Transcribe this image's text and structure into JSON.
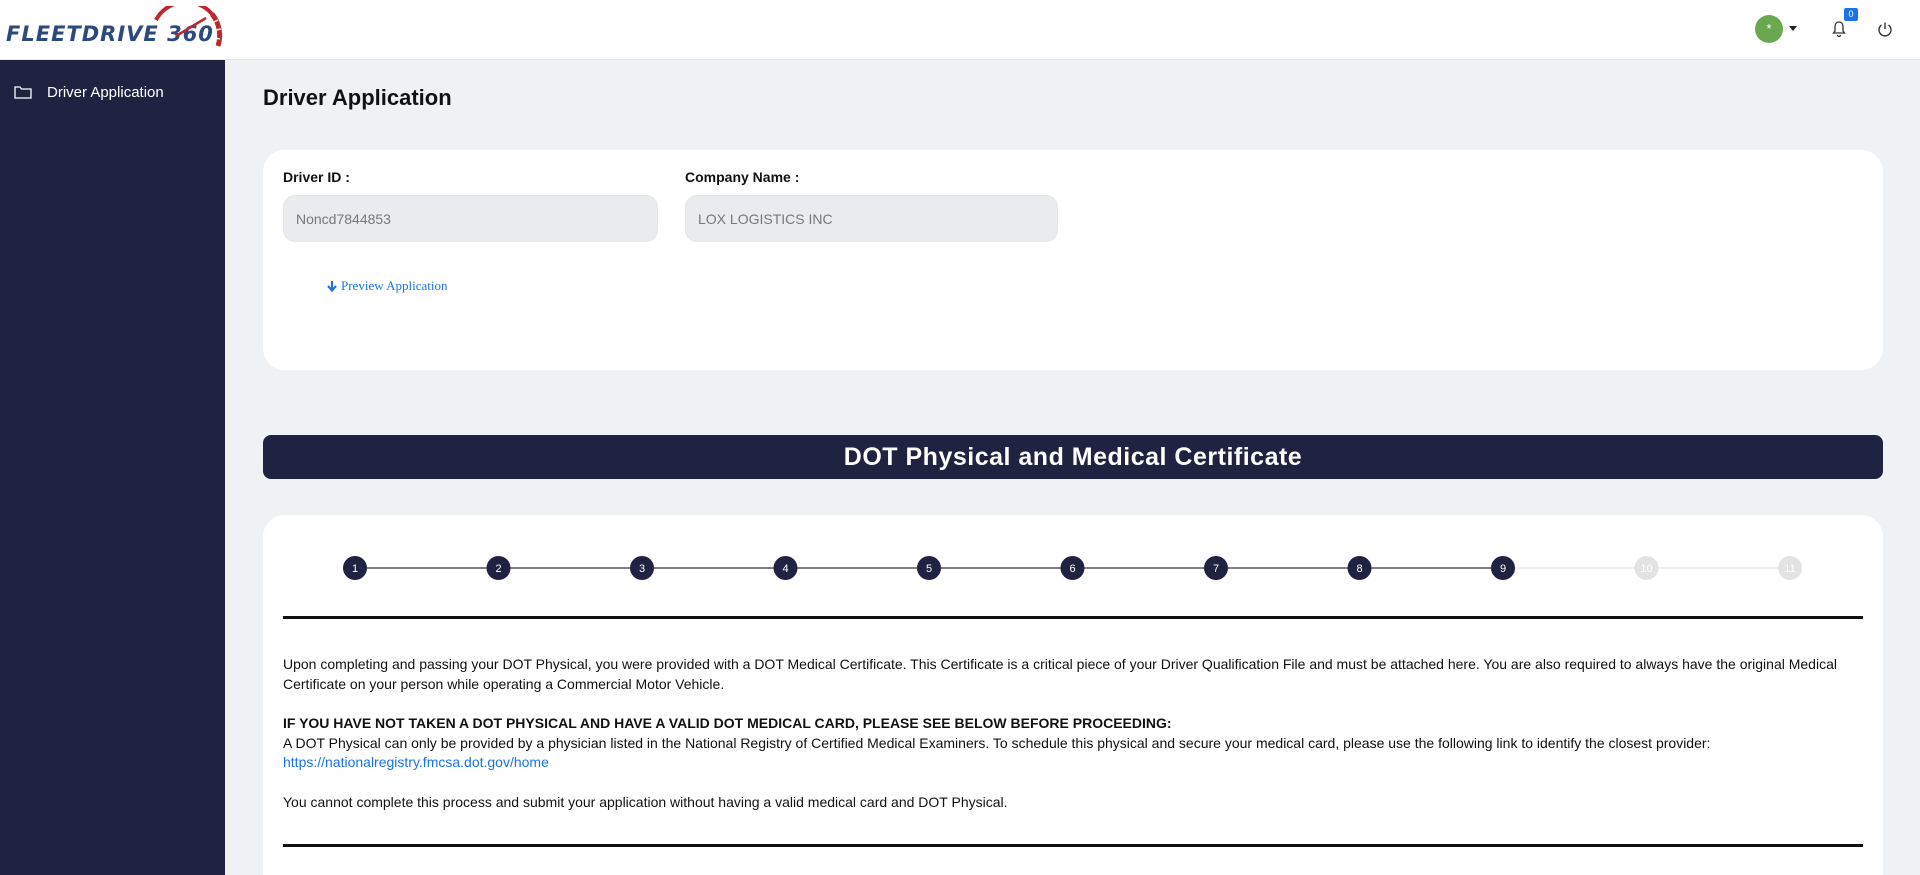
{
  "app": {
    "logo_text": "FLEETDRIVE",
    "logo_number": "360"
  },
  "header": {
    "avatar_initial": "*",
    "notification_count": "0"
  },
  "sidebar": {
    "items": [
      {
        "label": "Driver Application",
        "icon": "folder-icon"
      }
    ]
  },
  "page": {
    "title": "Driver Application"
  },
  "form": {
    "driver_id_label": "Driver ID :",
    "driver_id_value": "Noncd7844853",
    "company_name_label": "Company Name :",
    "company_name_value": "LOX LOGISTICS INC",
    "preview_label": "Preview Application"
  },
  "section": {
    "title": "DOT Physical and Medical Certificate"
  },
  "steps": {
    "labels": [
      "1",
      "2",
      "3",
      "4",
      "5",
      "6",
      "7",
      "8",
      "9",
      "10",
      "11"
    ],
    "completed": 9,
    "colors": {
      "active": "#1f2241",
      "inactive": "#e3e3e3",
      "line_active": "#333333",
      "line_inactive": "#e5e5e5"
    }
  },
  "content": {
    "para1": "Upon completing and passing your DOT Physical, you were provided with a DOT Medical Certificate. This Certificate is a critical piece of your Driver Qualification File and must be attached here. You are also required to always have the original Medical Certificate on your person while operating a Commercial Motor Vehicle.",
    "warning": "IF YOU HAVE NOT TAKEN A DOT PHYSICAL AND HAVE A VALID DOT MEDICAL CARD, PLEASE SEE BELOW BEFORE PROCEEDING:",
    "para2": "A DOT Physical can only be provided by a physician listed in the National Registry of Certified Medical Examiners. To schedule this physical and secure your medical card, please use the following link to identify the closest provider:",
    "link": "https://nationalregistry.fmcsa.dot.gov/home",
    "para3": "You cannot complete this process and submit your application without having a valid medical card and DOT Physical."
  },
  "colors": {
    "sidebar_bg": "#1f2241",
    "link": "#1a73e8",
    "avatar": "#6aa84f",
    "logo_red": "#c0272d",
    "logo_blue": "#2b4a7e"
  }
}
